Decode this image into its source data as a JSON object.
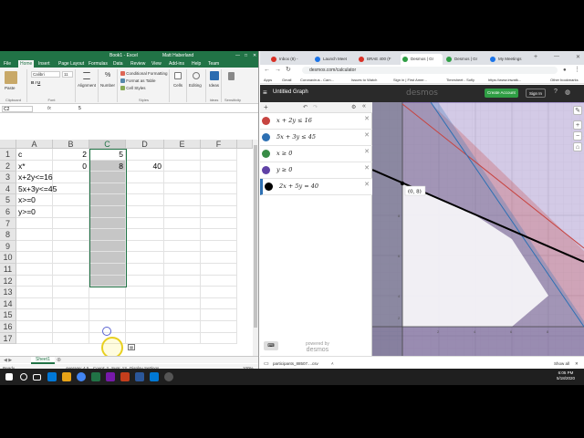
{
  "excel": {
    "title": "Book1 - Excel",
    "user": "Matt Haberland",
    "menu": [
      "File",
      "Home",
      "Insert",
      "Page Layout",
      "Formulas",
      "Data",
      "Review",
      "View",
      "Add-ins",
      "Help",
      "Team"
    ],
    "ribbon": {
      "paste": "Paste",
      "clipboard": "Clipboard",
      "font_name": "Calibri",
      "font_size": "11",
      "font_group": "Font",
      "alignment": "Alignment",
      "number": "Number",
      "conditional": "Conditional Formatting",
      "format_table": "Format as Table",
      "cell_styles": "Cell Styles",
      "styles": "Styles",
      "cells": "Cells",
      "editing": "Editing",
      "ideas": "Ideas",
      "ideas_group": "Ideas",
      "sensitivity": "Sensitivity"
    },
    "namebox": "C2",
    "formula_value": "5",
    "columns": [
      "A",
      "B",
      "C",
      "D",
      "E",
      "F"
    ],
    "rows": [
      "1",
      "2",
      "3",
      "4",
      "5",
      "6",
      "7",
      "8",
      "9",
      "10",
      "11",
      "12",
      "13",
      "14",
      "15",
      "16",
      "17"
    ],
    "cells": {
      "A1": "c",
      "B1": "2",
      "C1": "5",
      "A2": "x*",
      "B2": "0",
      "C2": "8",
      "D2": "40",
      "A3": "x+2y<=16",
      "A4": "5x+3y<=45",
      "A5": "x>=0",
      "A6": "y>=0"
    },
    "sheet_tab": "Sheet1",
    "status": {
      "ready": "Ready",
      "average": "Average: 4.5",
      "count": "Count: 2",
      "sum": "Sum: 13",
      "display": "Display Settings",
      "zoom": "100%"
    }
  },
  "chrome": {
    "tabs": [
      {
        "label": "Inbox (8) -",
        "color": "#d93025"
      },
      {
        "label": "Launch Meet",
        "color": "#1a73e8"
      },
      {
        "label": "BRAE 400 (F",
        "color": "#d93025"
      },
      {
        "label": "Desmos | Gr",
        "color": "#2f9e44"
      },
      {
        "label": "Desmos | Gr",
        "color": "#2f9e44"
      },
      {
        "label": "My Meetings",
        "color": "#1a73e8"
      }
    ],
    "url": "desmos.com/calculator",
    "bookmarks": [
      "Apps",
      "Gmail",
      "Coronavirus - Cam...",
      "Issues to Watch",
      "Sign in | First Amer...",
      "Timesheet - Sofly",
      "https://www.inwatk...",
      "Other bookmarks"
    ]
  },
  "desmos": {
    "graph_title": "Untitled Graph",
    "logo": "desmos",
    "create_account": "Create Account",
    "sign_in": "Sign In",
    "expressions": [
      {
        "tex": "x + 2y ≤ 16",
        "color": "#c74440"
      },
      {
        "tex": "5x + 3y ≤ 45",
        "color": "#2d70b3"
      },
      {
        "tex": "x ≥ 0",
        "color": "#388c46"
      },
      {
        "tex": "y ≥ 0",
        "color": "#6042a6"
      },
      {
        "tex": "2x + 5y = 40",
        "color": "#000000"
      }
    ],
    "point_label": "(0, 8)",
    "powered_by": "powered by",
    "powered_logo": "desmos",
    "x_tick_labels": [
      "2",
      "4",
      "6",
      "8"
    ],
    "y_tick_labels": [
      "8",
      "6",
      "4",
      "2"
    ]
  },
  "download": {
    "file": "participants_88507....csv",
    "show_all": "Show all"
  },
  "clock": {
    "time": "6:05 PM",
    "date": "5/18/2020"
  }
}
